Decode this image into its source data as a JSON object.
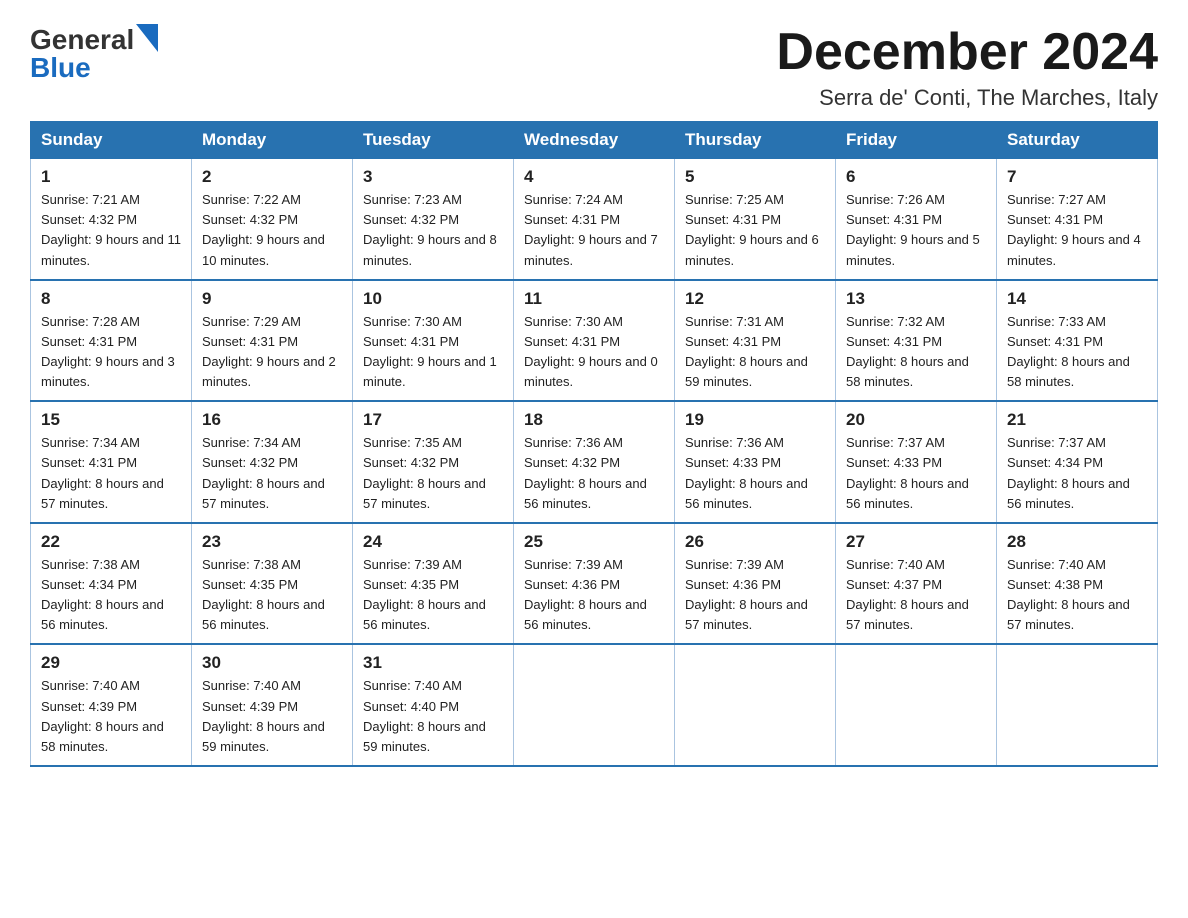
{
  "header": {
    "logo_general": "General",
    "logo_blue": "Blue",
    "month_title": "December 2024",
    "location": "Serra de' Conti, The Marches, Italy"
  },
  "days_of_week": [
    "Sunday",
    "Monday",
    "Tuesday",
    "Wednesday",
    "Thursday",
    "Friday",
    "Saturday"
  ],
  "weeks": [
    [
      {
        "day": "1",
        "sunrise": "7:21 AM",
        "sunset": "4:32 PM",
        "daylight": "9 hours and 11 minutes."
      },
      {
        "day": "2",
        "sunrise": "7:22 AM",
        "sunset": "4:32 PM",
        "daylight": "9 hours and 10 minutes."
      },
      {
        "day": "3",
        "sunrise": "7:23 AM",
        "sunset": "4:32 PM",
        "daylight": "9 hours and 8 minutes."
      },
      {
        "day": "4",
        "sunrise": "7:24 AM",
        "sunset": "4:31 PM",
        "daylight": "9 hours and 7 minutes."
      },
      {
        "day": "5",
        "sunrise": "7:25 AM",
        "sunset": "4:31 PM",
        "daylight": "9 hours and 6 minutes."
      },
      {
        "day": "6",
        "sunrise": "7:26 AM",
        "sunset": "4:31 PM",
        "daylight": "9 hours and 5 minutes."
      },
      {
        "day": "7",
        "sunrise": "7:27 AM",
        "sunset": "4:31 PM",
        "daylight": "9 hours and 4 minutes."
      }
    ],
    [
      {
        "day": "8",
        "sunrise": "7:28 AM",
        "sunset": "4:31 PM",
        "daylight": "9 hours and 3 minutes."
      },
      {
        "day": "9",
        "sunrise": "7:29 AM",
        "sunset": "4:31 PM",
        "daylight": "9 hours and 2 minutes."
      },
      {
        "day": "10",
        "sunrise": "7:30 AM",
        "sunset": "4:31 PM",
        "daylight": "9 hours and 1 minute."
      },
      {
        "day": "11",
        "sunrise": "7:30 AM",
        "sunset": "4:31 PM",
        "daylight": "9 hours and 0 minutes."
      },
      {
        "day": "12",
        "sunrise": "7:31 AM",
        "sunset": "4:31 PM",
        "daylight": "8 hours and 59 minutes."
      },
      {
        "day": "13",
        "sunrise": "7:32 AM",
        "sunset": "4:31 PM",
        "daylight": "8 hours and 58 minutes."
      },
      {
        "day": "14",
        "sunrise": "7:33 AM",
        "sunset": "4:31 PM",
        "daylight": "8 hours and 58 minutes."
      }
    ],
    [
      {
        "day": "15",
        "sunrise": "7:34 AM",
        "sunset": "4:31 PM",
        "daylight": "8 hours and 57 minutes."
      },
      {
        "day": "16",
        "sunrise": "7:34 AM",
        "sunset": "4:32 PM",
        "daylight": "8 hours and 57 minutes."
      },
      {
        "day": "17",
        "sunrise": "7:35 AM",
        "sunset": "4:32 PM",
        "daylight": "8 hours and 57 minutes."
      },
      {
        "day": "18",
        "sunrise": "7:36 AM",
        "sunset": "4:32 PM",
        "daylight": "8 hours and 56 minutes."
      },
      {
        "day": "19",
        "sunrise": "7:36 AM",
        "sunset": "4:33 PM",
        "daylight": "8 hours and 56 minutes."
      },
      {
        "day": "20",
        "sunrise": "7:37 AM",
        "sunset": "4:33 PM",
        "daylight": "8 hours and 56 minutes."
      },
      {
        "day": "21",
        "sunrise": "7:37 AM",
        "sunset": "4:34 PM",
        "daylight": "8 hours and 56 minutes."
      }
    ],
    [
      {
        "day": "22",
        "sunrise": "7:38 AM",
        "sunset": "4:34 PM",
        "daylight": "8 hours and 56 minutes."
      },
      {
        "day": "23",
        "sunrise": "7:38 AM",
        "sunset": "4:35 PM",
        "daylight": "8 hours and 56 minutes."
      },
      {
        "day": "24",
        "sunrise": "7:39 AM",
        "sunset": "4:35 PM",
        "daylight": "8 hours and 56 minutes."
      },
      {
        "day": "25",
        "sunrise": "7:39 AM",
        "sunset": "4:36 PM",
        "daylight": "8 hours and 56 minutes."
      },
      {
        "day": "26",
        "sunrise": "7:39 AM",
        "sunset": "4:36 PM",
        "daylight": "8 hours and 57 minutes."
      },
      {
        "day": "27",
        "sunrise": "7:40 AM",
        "sunset": "4:37 PM",
        "daylight": "8 hours and 57 minutes."
      },
      {
        "day": "28",
        "sunrise": "7:40 AM",
        "sunset": "4:38 PM",
        "daylight": "8 hours and 57 minutes."
      }
    ],
    [
      {
        "day": "29",
        "sunrise": "7:40 AM",
        "sunset": "4:39 PM",
        "daylight": "8 hours and 58 minutes."
      },
      {
        "day": "30",
        "sunrise": "7:40 AM",
        "sunset": "4:39 PM",
        "daylight": "8 hours and 59 minutes."
      },
      {
        "day": "31",
        "sunrise": "7:40 AM",
        "sunset": "4:40 PM",
        "daylight": "8 hours and 59 minutes."
      },
      null,
      null,
      null,
      null
    ]
  ],
  "labels": {
    "sunrise": "Sunrise:",
    "sunset": "Sunset:",
    "daylight": "Daylight:"
  }
}
